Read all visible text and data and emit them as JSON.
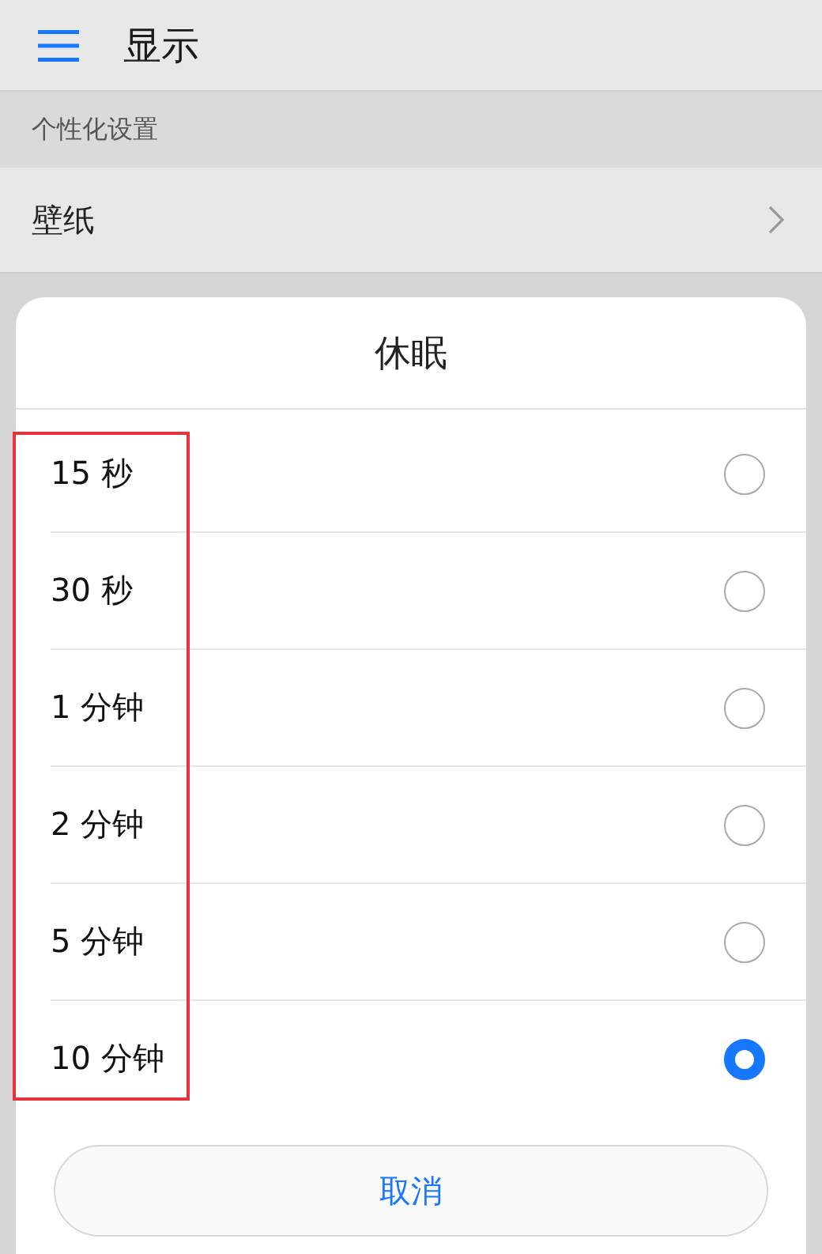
{
  "app_bar": {
    "title": "显示"
  },
  "section": {
    "title": "个性化设置"
  },
  "rows": [
    {
      "label": "壁纸"
    }
  ],
  "dialog": {
    "title": "休眠",
    "options": [
      {
        "label": "15 秒",
        "selected": false
      },
      {
        "label": "30 秒",
        "selected": false
      },
      {
        "label": "1 分钟",
        "selected": false
      },
      {
        "label": "2 分钟",
        "selected": false
      },
      {
        "label": "5 分钟",
        "selected": false
      },
      {
        "label": "10 分钟",
        "selected": true
      }
    ],
    "cancel": "取消"
  }
}
